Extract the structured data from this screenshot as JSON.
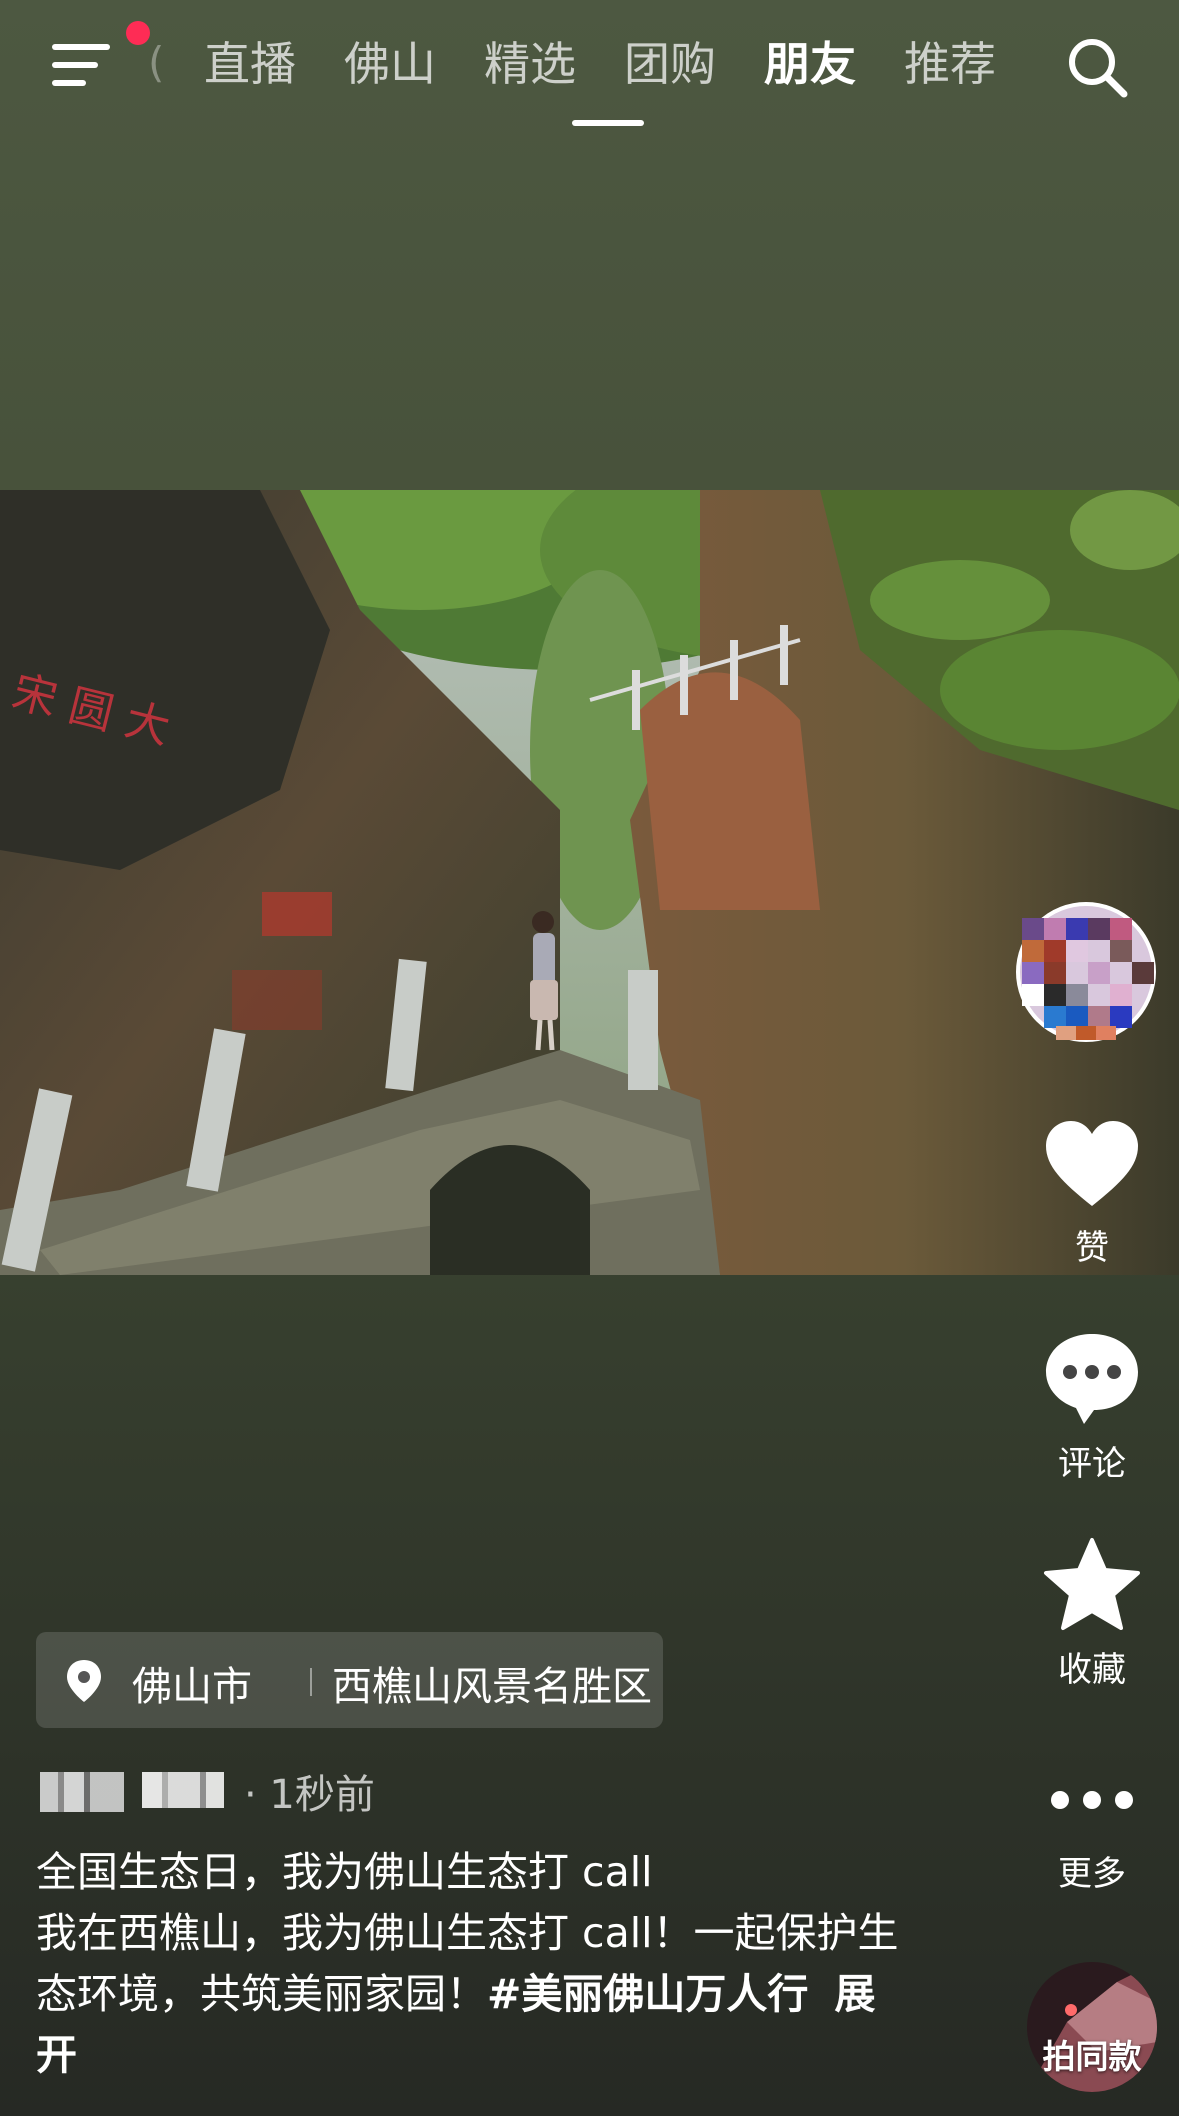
{
  "nav": {
    "tabs": [
      {
        "label": "直播",
        "active": false
      },
      {
        "label": "佛山",
        "active": false
      },
      {
        "label": "精选",
        "active": false
      },
      {
        "label": "团购",
        "active": false
      },
      {
        "label": "朋友",
        "active": true
      },
      {
        "label": "推荐",
        "active": false
      }
    ],
    "notification_dot_color": "#fe2c55",
    "menu_icon": "menu-icon",
    "search_icon": "search-icon"
  },
  "actions": {
    "like_label": "赞",
    "comment_label": "评论",
    "favorite_label": "收藏",
    "more_label": "更多",
    "same_style_label": "拍同款"
  },
  "location": {
    "city": "佛山市",
    "place": "西樵山风景名胜区"
  },
  "post": {
    "time": "· 1秒前",
    "line1": "全国生态日，我为佛山生态打 call",
    "line2_text": "我在西樵山，我为佛山生态打 call！一起保护生态环境，共筑美丽家园！",
    "hashtag": "#美丽佛山万人行",
    "expand_label": "展开"
  }
}
